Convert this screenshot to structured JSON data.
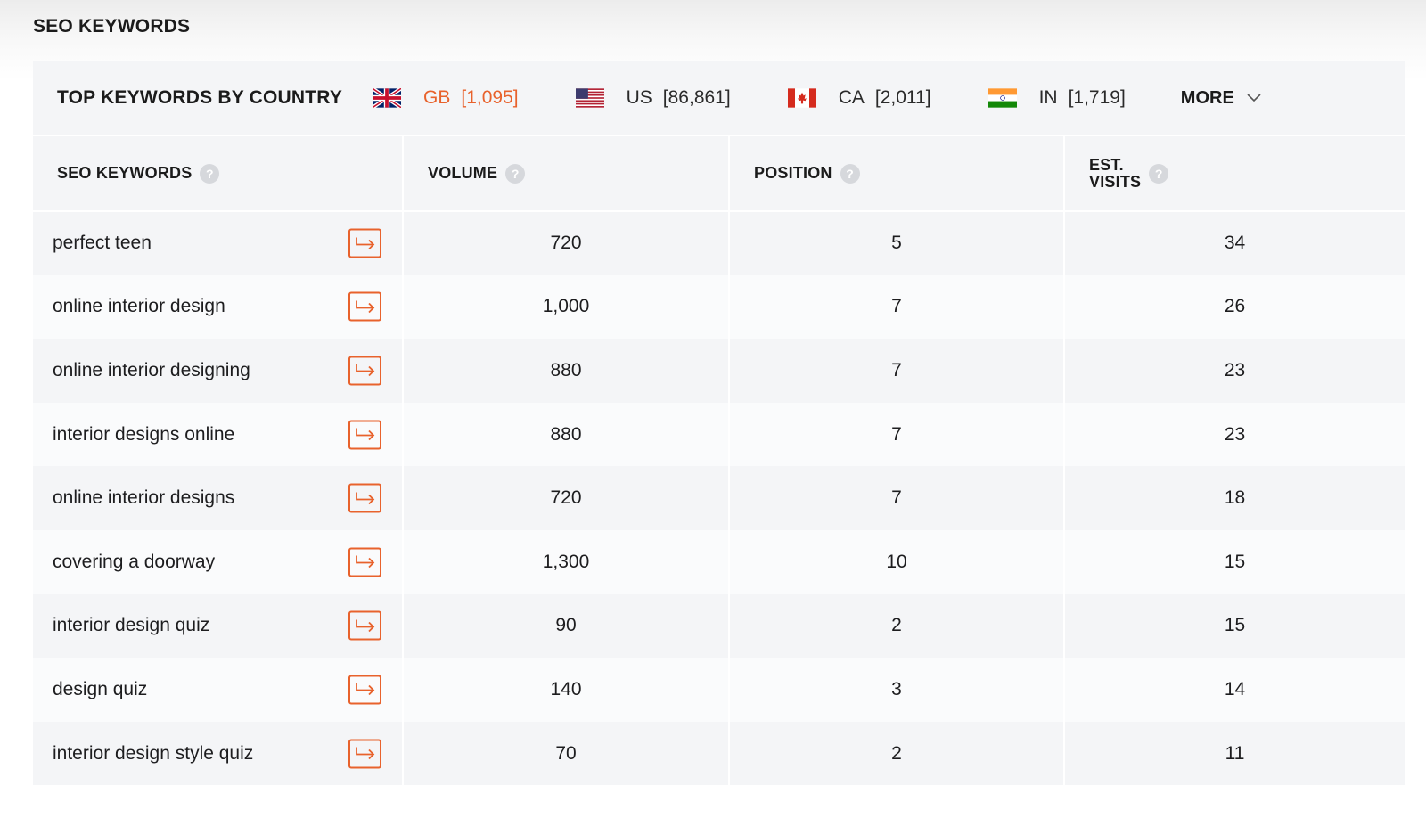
{
  "section_title": "SEO KEYWORDS",
  "country_bar": {
    "label": "TOP KEYWORDS BY COUNTRY",
    "countries": [
      {
        "code": "GB",
        "count": "[1,095]",
        "flag": "uk-flag-icon"
      },
      {
        "code": "US",
        "count": "[86,861]",
        "flag": "us-flag-icon"
      },
      {
        "code": "CA",
        "count": "[2,011]",
        "flag": "canada-flag-icon"
      },
      {
        "code": "IN",
        "count": "[1,719]",
        "flag": "india-flag-icon"
      }
    ],
    "more_label": "MORE",
    "active_color": "#e8622c"
  },
  "table": {
    "headers": {
      "keywords": "SEO KEYWORDS",
      "volume": "VOLUME",
      "position": "POSITION",
      "visits_line1": "EST.",
      "visits_line2": "VISITS"
    },
    "help_glyph": "?",
    "rows": [
      {
        "keyword": "perfect teen",
        "volume": "720",
        "position": "5",
        "visits": "34"
      },
      {
        "keyword": "online interior design",
        "volume": "1,000",
        "position": "7",
        "visits": "26"
      },
      {
        "keyword": "online interior designing",
        "volume": "880",
        "position": "7",
        "visits": "23"
      },
      {
        "keyword": "interior designs online",
        "volume": "880",
        "position": "7",
        "visits": "23"
      },
      {
        "keyword": "online interior designs",
        "volume": "720",
        "position": "7",
        "visits": "18"
      },
      {
        "keyword": "covering a doorway",
        "volume": "1,300",
        "position": "10",
        "visits": "15"
      },
      {
        "keyword": "interior design quiz",
        "volume": "90",
        "position": "2",
        "visits": "15"
      },
      {
        "keyword": "design quiz",
        "volume": "140",
        "position": "3",
        "visits": "14"
      },
      {
        "keyword": "interior design style quiz",
        "volume": "70",
        "position": "2",
        "visits": "11"
      }
    ]
  }
}
